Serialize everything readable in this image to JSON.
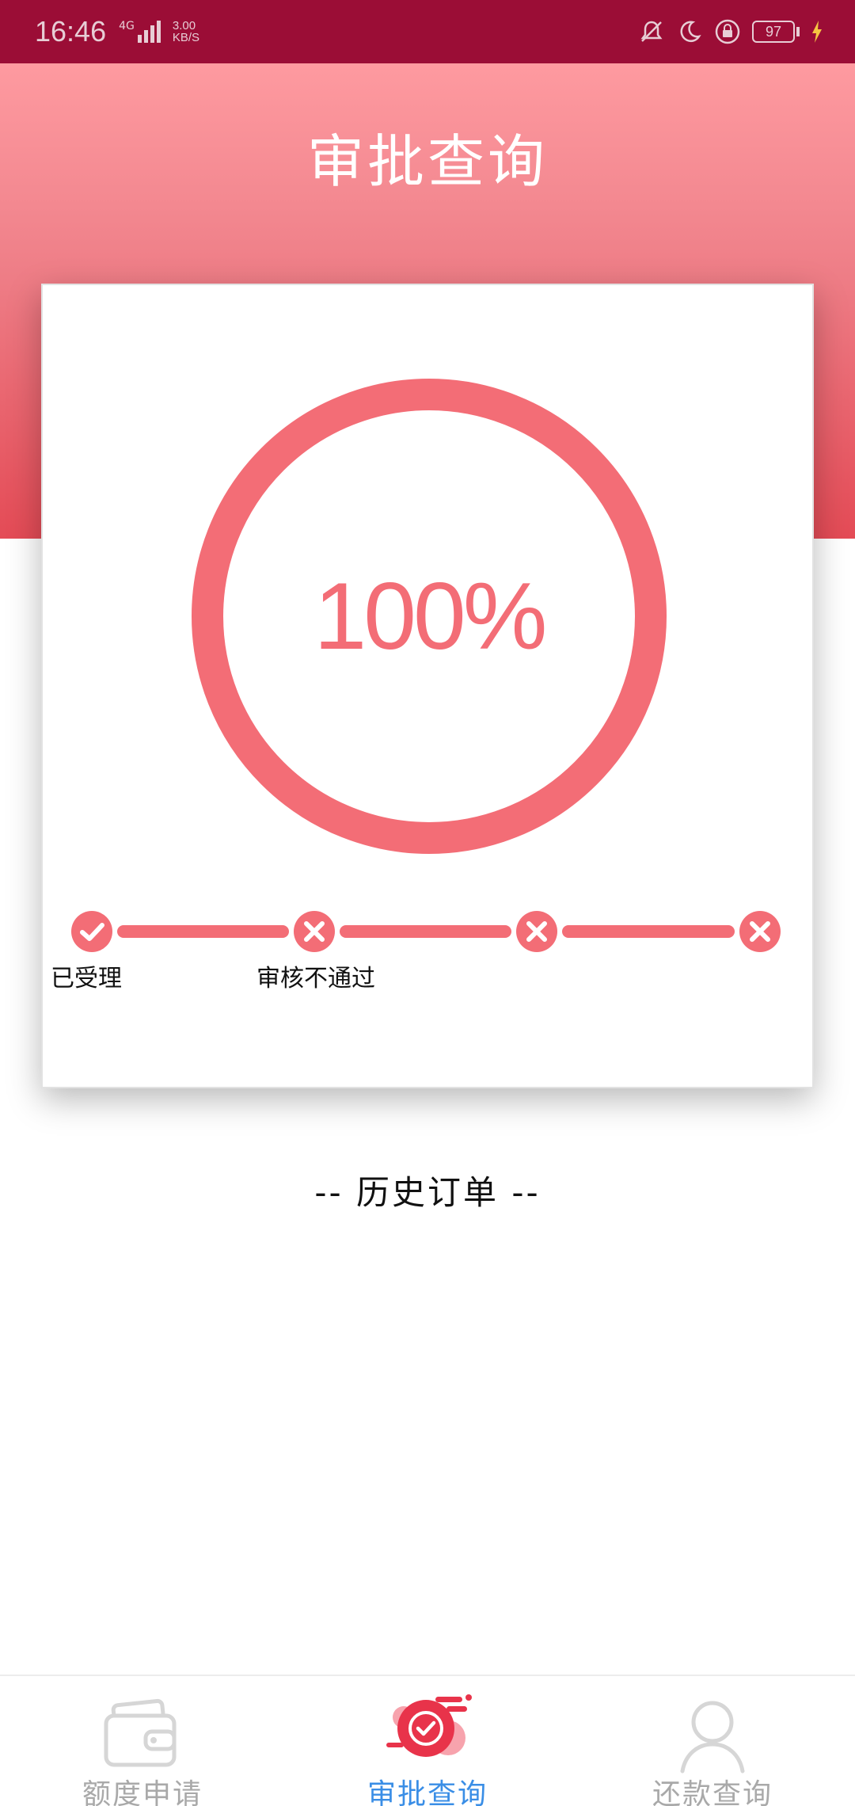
{
  "status_bar": {
    "time": "16:46",
    "network": "4G",
    "speed_value": "3.00",
    "speed_unit": "KB/S",
    "battery": "97",
    "icons": [
      "bell-off-icon",
      "moon-icon",
      "rotation-lock-icon",
      "battery-icon",
      "charging-icon"
    ]
  },
  "header": {
    "title": "审批查询"
  },
  "progress": {
    "percent_text": "100%",
    "percent_value": 100,
    "color": "#f36d76"
  },
  "steps": [
    {
      "label": "已受理",
      "status": "done"
    },
    {
      "label": "审核不通过",
      "status": "failed"
    },
    {
      "label": "",
      "status": "failed"
    },
    {
      "label": "",
      "status": "failed"
    }
  ],
  "history": {
    "title": "-- 历史订单 --"
  },
  "tab_bar": {
    "active_color": "#3a8ee6",
    "inactive_color": "#a9a9a9",
    "tabs": [
      {
        "label": "额度申请",
        "icon": "wallet-icon",
        "active": false
      },
      {
        "label": "审批查询",
        "icon": "approval-check-icon",
        "active": true
      },
      {
        "label": "还款查询",
        "icon": "user-icon",
        "active": false
      }
    ]
  }
}
